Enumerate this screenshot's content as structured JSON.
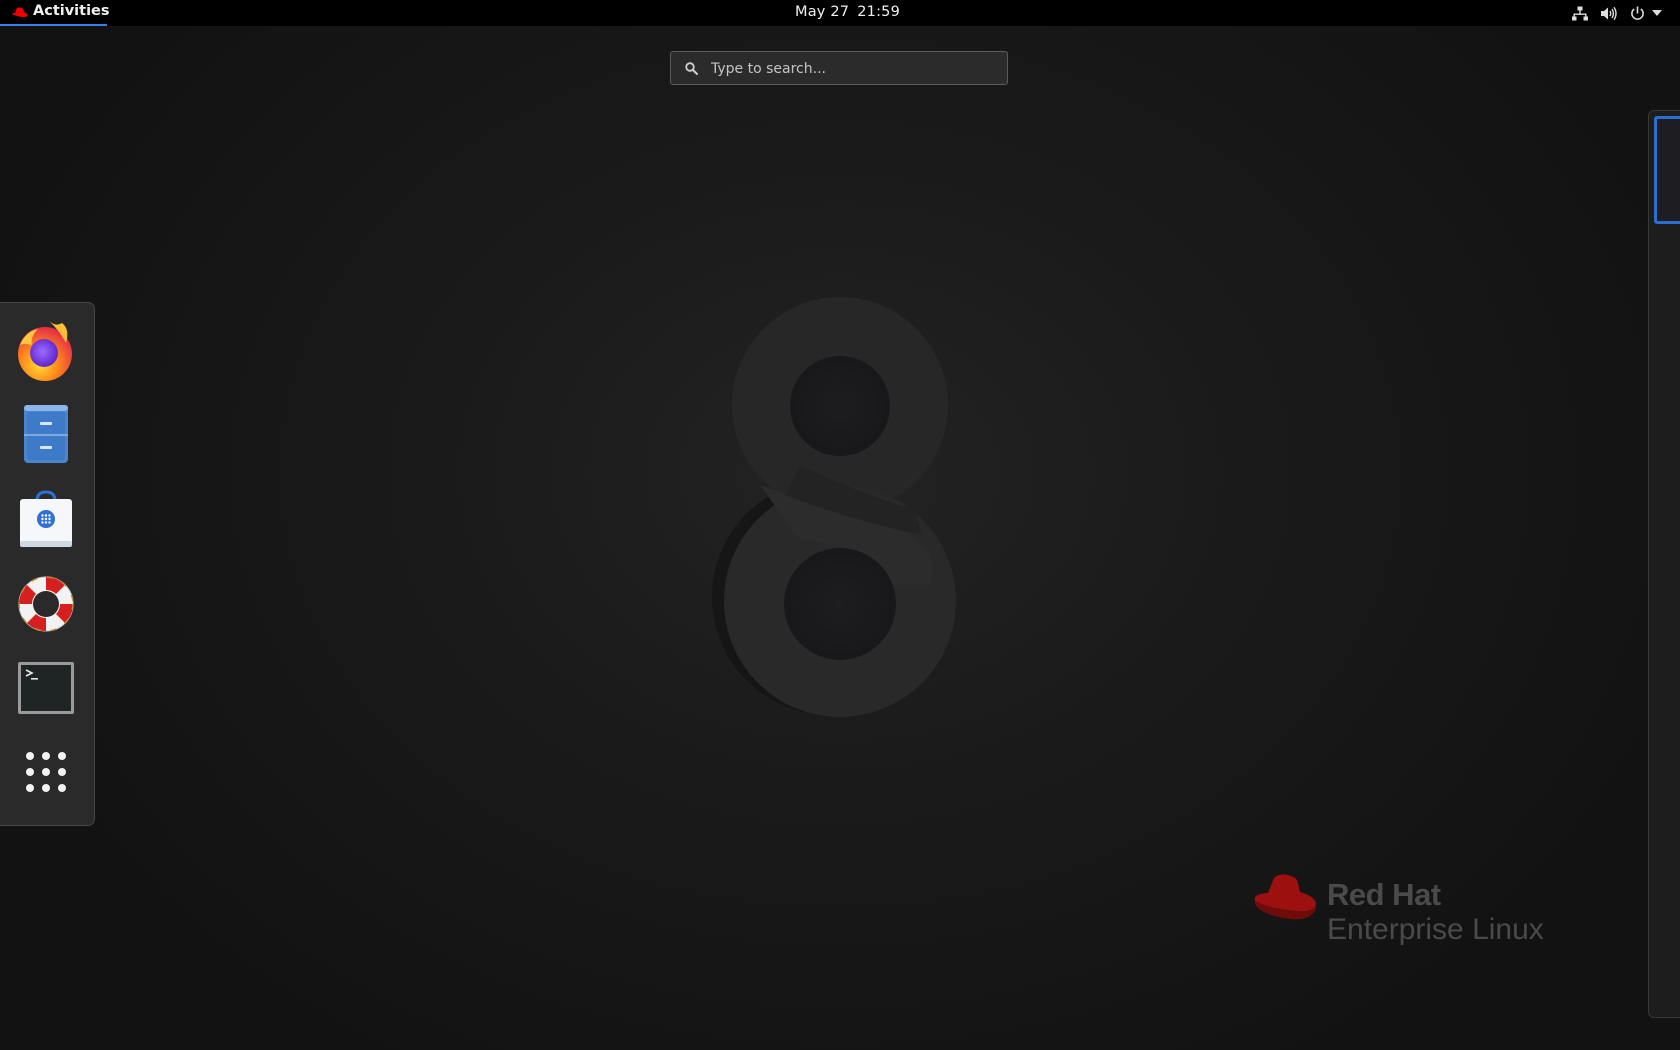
{
  "topbar": {
    "activities_label": "Activities",
    "clock_date": "May 27",
    "clock_time": "21:59",
    "tray_icons": [
      "network-icon",
      "volume-icon",
      "power-icon",
      "chevron-down-icon"
    ]
  },
  "search": {
    "placeholder": "Type to search..."
  },
  "dash": {
    "items": [
      {
        "name": "firefox-icon"
      },
      {
        "name": "files-icon"
      },
      {
        "name": "software-icon"
      },
      {
        "name": "help-icon"
      },
      {
        "name": "terminal-icon"
      },
      {
        "name": "show-applications-icon"
      }
    ]
  },
  "wallpaper": {
    "brand_line1": "Red Hat",
    "brand_line2": "Enterprise Linux"
  },
  "colors": {
    "accent": "#3584e4",
    "redhat_red": "#cc1a1a",
    "topbar_bg": "#000000"
  }
}
